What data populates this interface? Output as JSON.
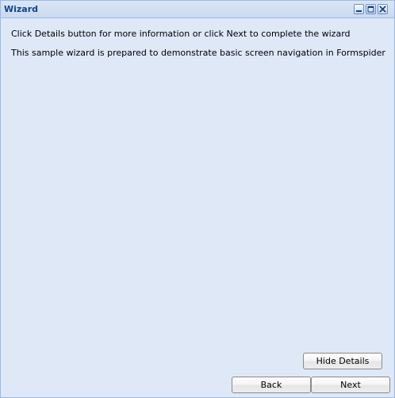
{
  "window": {
    "title": "Wizard",
    "tools": {
      "minimize_icon": "minimize-icon",
      "maximize_icon": "maximize-icon",
      "close_icon": "close-icon"
    }
  },
  "content": {
    "line1": "Click Details button for more information or click Next to complete the wizard",
    "line2": "This sample wizard is prepared to demonstrate basic screen navigation in Formspider"
  },
  "buttons": {
    "hide_details": "Hide Details",
    "back": "Back",
    "next": "Next"
  },
  "colors": {
    "window_background": "#dfe8f6",
    "title_text": "#15428b",
    "border": "#99bbe8"
  }
}
